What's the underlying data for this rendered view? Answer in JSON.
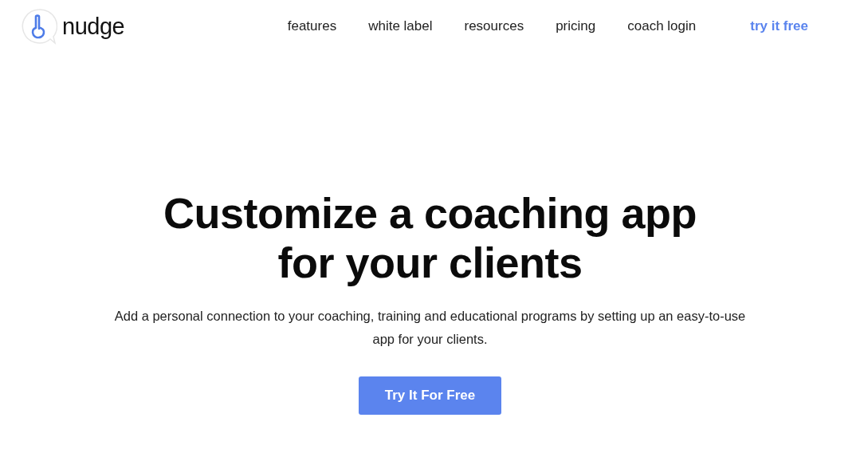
{
  "logo": {
    "text": "nudge"
  },
  "nav": [
    {
      "label": "features",
      "kind": "link"
    },
    {
      "label": "white label",
      "kind": "link"
    },
    {
      "label": "resources",
      "kind": "link"
    },
    {
      "label": "pricing",
      "kind": "link"
    },
    {
      "label": "coach login",
      "kind": "link"
    },
    {
      "label": "try it free",
      "kind": "cta"
    }
  ],
  "hero": {
    "title_lines": [
      "Customize a coaching app",
      "for your clients"
    ],
    "subtitle": "Add a personal connection to your coaching, training and educational programs by setting up an easy-to-use app for your clients.",
    "button": "Try It For Free"
  }
}
